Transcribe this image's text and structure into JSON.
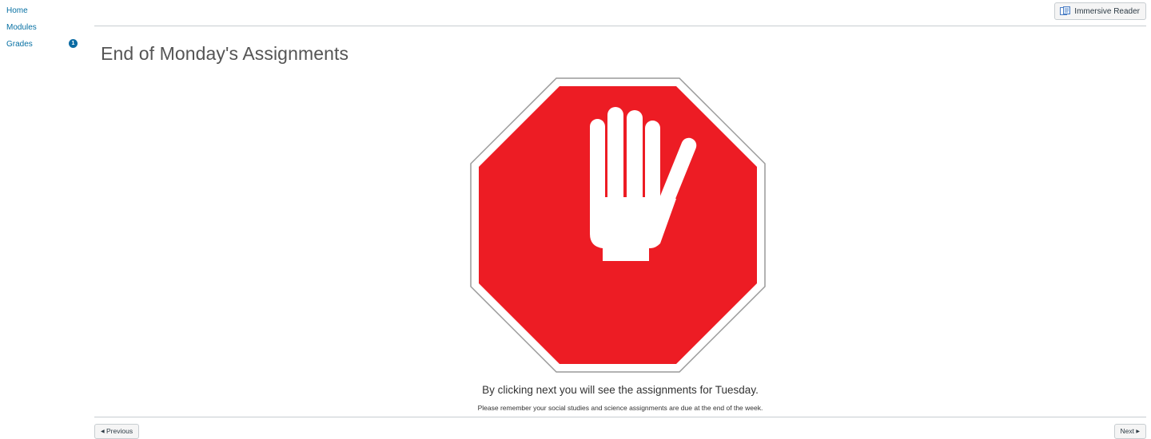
{
  "course_nav": {
    "items": [
      {
        "label": "Home"
      },
      {
        "label": "Modules"
      },
      {
        "label": "Grades",
        "badge": "1"
      }
    ]
  },
  "toolbar": {
    "immersive_reader_label": "Immersive Reader",
    "immersive_reader_icon": "book-reader-icon"
  },
  "page": {
    "title": "End of Monday's Assignments",
    "image": {
      "icon": "stop-hand-icon",
      "colors": {
        "octagon": "#ed1c24",
        "border": "#ffffff",
        "hand": "#ffffff"
      }
    },
    "message_line_1": "By clicking next you will see the assignments for Tuesday.",
    "message_line_2": "Please remember your social studies and science assignments are due at the end of the week."
  },
  "footer": {
    "previous_label": "Previous",
    "next_label": "Next"
  },
  "colors": {
    "link": "#0770a3",
    "badge": "#0b6ba3",
    "title_text": "#555555",
    "divider": "#c7cdd1"
  }
}
